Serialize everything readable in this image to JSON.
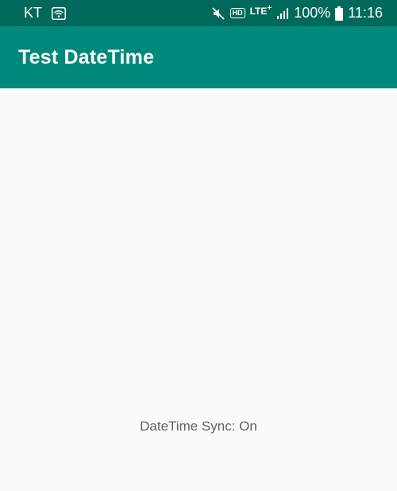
{
  "status_bar": {
    "carrier": "KT",
    "network_type": "LTE",
    "network_plus": "+",
    "hd_label": "HD",
    "battery": "100%",
    "time": "11:16",
    "icons": [
      "wifi-icon",
      "mute-icon",
      "hd-voice-icon",
      "lte-icon",
      "signal-icon",
      "battery-icon"
    ]
  },
  "app_bar": {
    "title": "Test DateTime"
  },
  "main": {
    "sync_status": "DateTime Sync: On"
  },
  "colors": {
    "status_bar": "#00695c",
    "app_bar": "#00897b",
    "background": "#fafafa",
    "text_secondary": "#616161"
  }
}
